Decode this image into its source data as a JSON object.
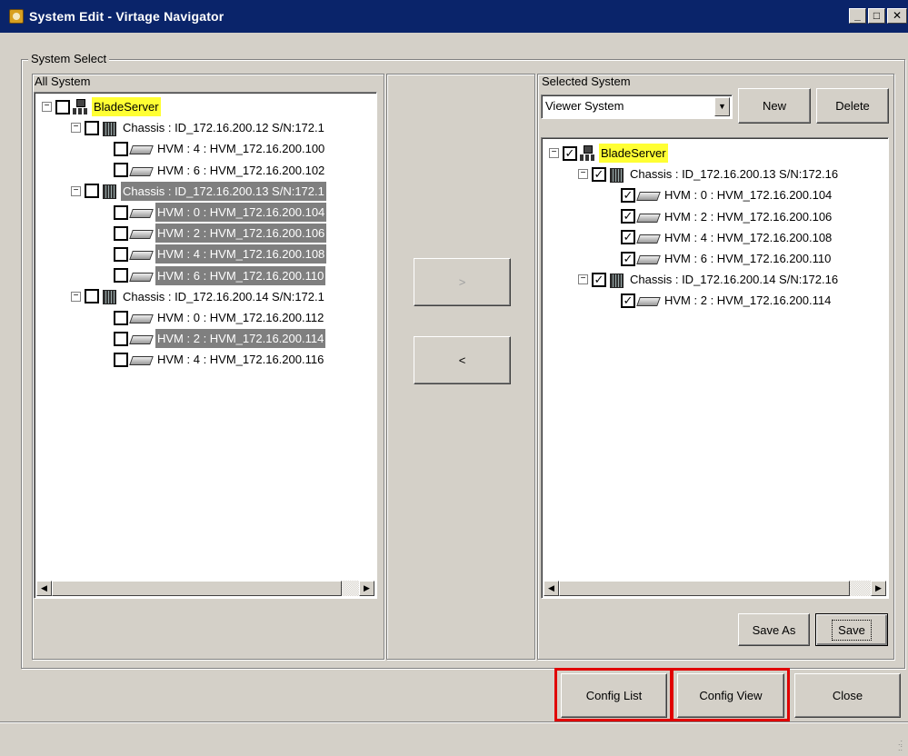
{
  "window": {
    "title": "System Edit - Virtage Navigator"
  },
  "group": {
    "label": "System Select"
  },
  "left": {
    "header": "All System",
    "tree": [
      {
        "label": "BladeServer",
        "level": 0,
        "icon": "network-icon",
        "expander": "⊟",
        "checked": false,
        "highlight": "yellow"
      },
      {
        "label": "Chassis : ID_172.16.200.12 S/N:172.1",
        "level": 1,
        "icon": "chassis-icon",
        "expander": "⊟",
        "checked": false,
        "highlight": "none"
      },
      {
        "label": "HVM : 4 : HVM_172.16.200.100",
        "level": 2,
        "icon": "blade-icon",
        "expander": "",
        "checked": false,
        "highlight": "none"
      },
      {
        "label": "HVM : 6 : HVM_172.16.200.102",
        "level": 2,
        "icon": "blade-icon",
        "expander": "",
        "checked": false,
        "highlight": "none"
      },
      {
        "label": "Chassis : ID_172.16.200.13 S/N:172.1",
        "level": 1,
        "icon": "chassis-icon",
        "expander": "⊟",
        "checked": false,
        "highlight": "gray-partial"
      },
      {
        "label": "HVM : 0 : HVM_172.16.200.104",
        "level": 2,
        "icon": "blade-icon",
        "expander": "",
        "checked": false,
        "highlight": "gray"
      },
      {
        "label": "HVM : 2 : HVM_172.16.200.106",
        "level": 2,
        "icon": "blade-icon",
        "expander": "",
        "checked": false,
        "highlight": "gray"
      },
      {
        "label": "HVM : 4 : HVM_172.16.200.108",
        "level": 2,
        "icon": "blade-icon",
        "expander": "",
        "checked": false,
        "highlight": "gray"
      },
      {
        "label": "HVM : 6 : HVM_172.16.200.110",
        "level": 2,
        "icon": "blade-icon",
        "expander": "",
        "checked": false,
        "highlight": "gray"
      },
      {
        "label": "Chassis : ID_172.16.200.14 S/N:172.1",
        "level": 1,
        "icon": "chassis-icon",
        "expander": "⊟",
        "checked": false,
        "highlight": "none"
      },
      {
        "label": "HVM : 0 : HVM_172.16.200.112",
        "level": 2,
        "icon": "blade-icon",
        "expander": "",
        "checked": false,
        "highlight": "none"
      },
      {
        "label": "HVM : 2 : HVM_172.16.200.114",
        "level": 2,
        "icon": "blade-icon",
        "expander": "",
        "checked": false,
        "highlight": "gray"
      },
      {
        "label": "HVM : 4 : HVM_172.16.200.116",
        "level": 2,
        "icon": "blade-icon",
        "expander": "",
        "checked": false,
        "highlight": "none"
      }
    ]
  },
  "middle": {
    "add_label": ">",
    "remove_label": "<"
  },
  "right": {
    "header": "Selected System",
    "combo_value": "Viewer System",
    "new_label": "New",
    "delete_label": "Delete",
    "save_as_label": "Save As",
    "save_label": "Save",
    "tree": [
      {
        "label": "BladeServer",
        "level": 0,
        "icon": "network-icon",
        "expander": "⊟",
        "checked": true,
        "highlight": "yellow"
      },
      {
        "label": "Chassis : ID_172.16.200.13 S/N:172.16",
        "level": 1,
        "icon": "chassis-icon",
        "expander": "⊟",
        "checked": true,
        "highlight": "none"
      },
      {
        "label": "HVM : 0 : HVM_172.16.200.104",
        "level": 2,
        "icon": "blade-icon",
        "expander": "",
        "checked": true,
        "highlight": "none"
      },
      {
        "label": "HVM : 2 : HVM_172.16.200.106",
        "level": 2,
        "icon": "blade-icon",
        "expander": "",
        "checked": true,
        "highlight": "none"
      },
      {
        "label": "HVM : 4 : HVM_172.16.200.108",
        "level": 2,
        "icon": "blade-icon",
        "expander": "",
        "checked": true,
        "highlight": "none"
      },
      {
        "label": "HVM : 6 : HVM_172.16.200.110",
        "level": 2,
        "icon": "blade-icon",
        "expander": "",
        "checked": true,
        "highlight": "none"
      },
      {
        "label": "Chassis : ID_172.16.200.14 S/N:172.16",
        "level": 1,
        "icon": "chassis-icon",
        "expander": "⊟",
        "checked": true,
        "highlight": "none"
      },
      {
        "label": "HVM : 2 : HVM_172.16.200.114",
        "level": 2,
        "icon": "blade-icon",
        "expander": "",
        "checked": true,
        "highlight": "none"
      }
    ]
  },
  "footer": {
    "config_list_label": "Config List",
    "config_view_label": "Config View",
    "close_label": "Close"
  },
  "colors": {
    "title_bar": "#0a246a",
    "highlight_yellow": "#ffff33",
    "highlight_gray": "#7f7f7f",
    "annotation_red": "#e00000"
  }
}
